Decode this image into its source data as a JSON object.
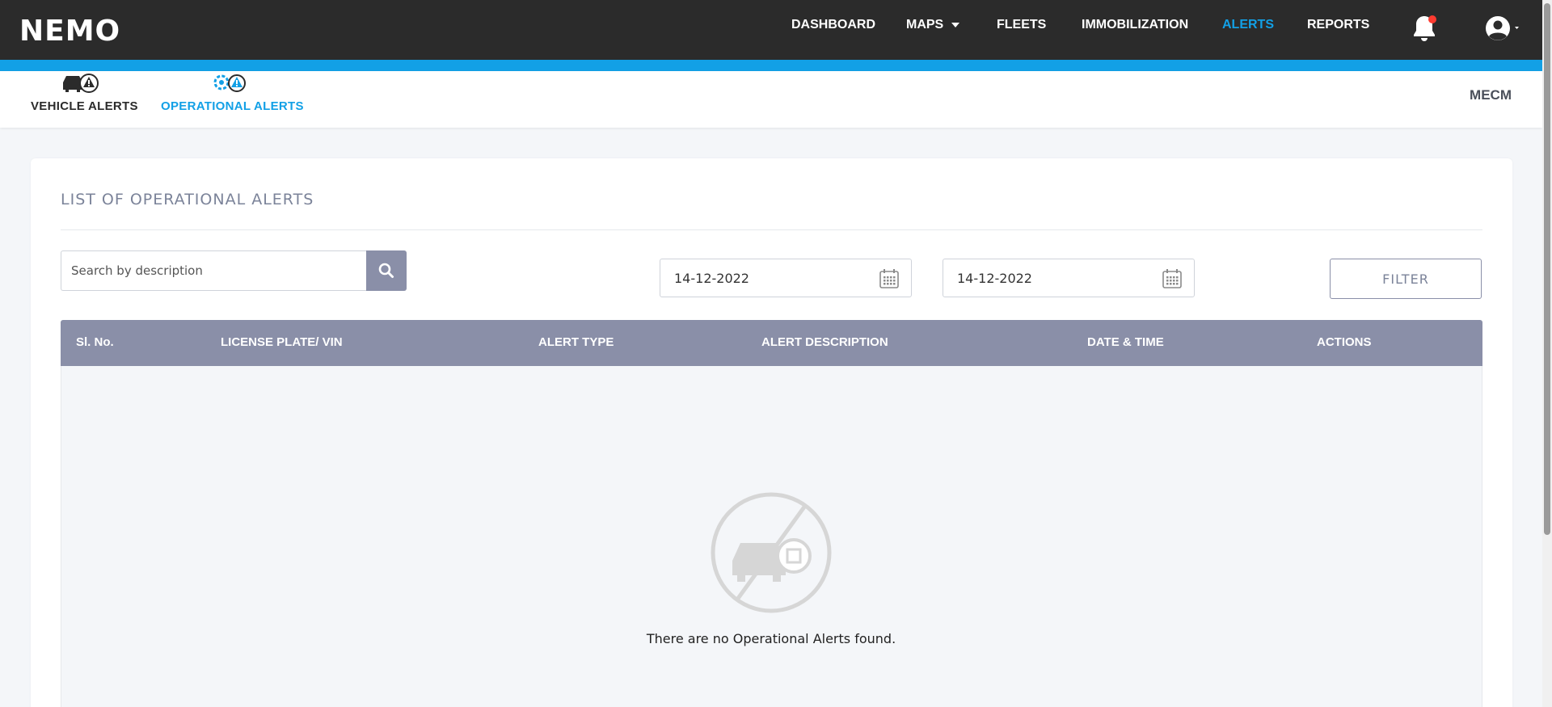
{
  "app": {
    "logo": "NEMO"
  },
  "nav": {
    "items": [
      {
        "label": "DASHBOARD"
      },
      {
        "label": "MAPS"
      },
      {
        "label": "FLEETS"
      },
      {
        "label": "IMMOBILIZATION"
      },
      {
        "label": "ALERTS"
      },
      {
        "label": "REPORTS"
      }
    ],
    "active": "ALERTS",
    "notification_dot_color": "#ff3b30"
  },
  "subnav": {
    "tabs": [
      {
        "label": "VEHICLE ALERTS",
        "icon": "vehicle-alert-icon"
      },
      {
        "label": "OPERATIONAL ALERTS",
        "icon": "operational-alert-icon"
      }
    ],
    "active_tab": "OPERATIONAL ALERTS",
    "org": "MECM"
  },
  "main": {
    "title": "LIST OF OPERATIONAL ALERTS",
    "search": {
      "placeholder": "Search by description",
      "value": ""
    },
    "date_from": "14-12-2022",
    "date_to": "14-12-2022",
    "filter_label": "FILTER",
    "table": {
      "columns": [
        "Sl. No.",
        "LICENSE PLATE/ VIN",
        "ALERT TYPE",
        "ALERT DESCRIPTION",
        "DATE & TIME",
        "ACTIONS"
      ],
      "rows": []
    },
    "empty_message": "There are no Operational Alerts found."
  },
  "colors": {
    "accent": "#12a0e6",
    "topbar": "#2b2b2b",
    "table_header": "#8a8fa8"
  }
}
